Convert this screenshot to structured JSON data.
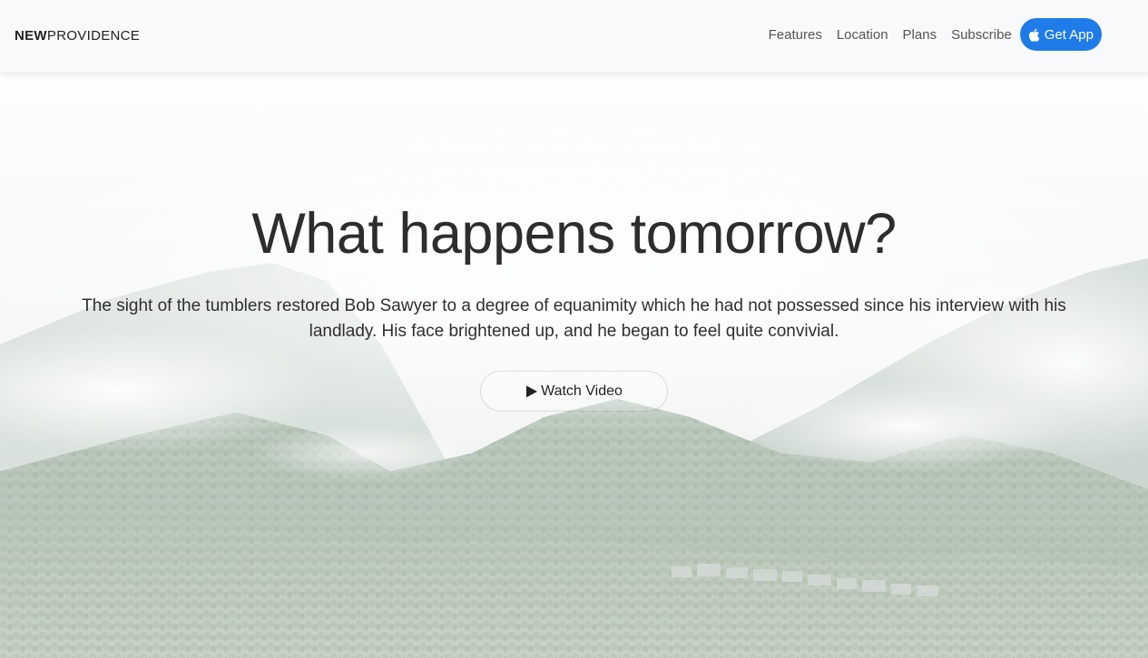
{
  "brand": {
    "bold": "NEW",
    "regular": "PROVIDENCE"
  },
  "nav": {
    "links": [
      "Features",
      "Location",
      "Plans",
      "Subscribe"
    ],
    "cta": {
      "label": "Get App",
      "icon": "apple-icon"
    }
  },
  "hero": {
    "title": "What happens tomorrow?",
    "text": "The sight of the tumblers restored Bob Sawyer to a degree of equanimity which he had not possessed since his interview with his landlady. His face brightened up, and he began to feel quite convivial.",
    "button": {
      "label": "Watch Video",
      "icon": "play-icon"
    },
    "background": "mountain-forest-fog-image"
  },
  "colors": {
    "accent": "#1f7be8",
    "navbar_bg": "#f8f9fa",
    "text_dark": "#2d2d2d",
    "nav_text": "#555555"
  }
}
